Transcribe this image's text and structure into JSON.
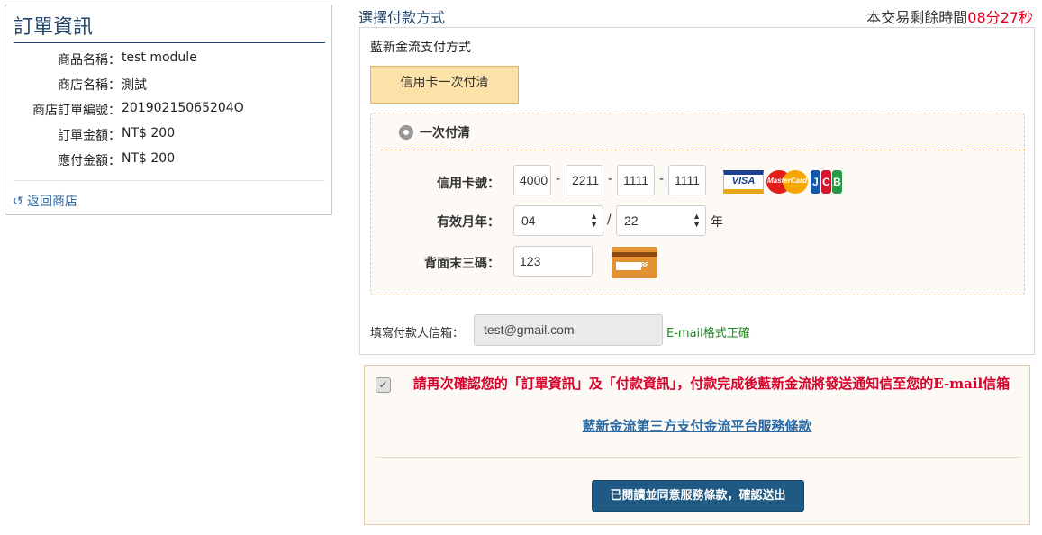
{
  "order": {
    "title": "訂單資訊",
    "rows": [
      {
        "key": "商品名稱：",
        "value": "test module"
      },
      {
        "key": "商店名稱：",
        "value": "測試"
      },
      {
        "key": "商店訂單編號：",
        "value": "20190215065204O"
      },
      {
        "key": "訂單金額：",
        "value": "NT$ 200"
      },
      {
        "key": "應付金額：",
        "value": "NT$ 200"
      }
    ],
    "back_link": "返回商店",
    "back_icon": "undo-icon"
  },
  "payment": {
    "heading": "選擇付款方式",
    "timer_label": "本交易剩餘時間",
    "timer_value": "08分27秒",
    "method_title": "藍新金流支付方式",
    "method_button": "信用卡一次付清",
    "option_label": "一次付清",
    "card_number_label": "信用卡號：",
    "card_number": [
      "4000",
      "2211",
      "1111",
      "1111"
    ],
    "separator": "-",
    "expiry_label": "有效月年：",
    "expiry_month": "04",
    "expiry_slash": "/",
    "expiry_year": "22",
    "expiry_suffix": "年",
    "cvv_label": "背面末三碼：",
    "cvv": "123",
    "cvv_icon_text": "888",
    "card_brands": [
      "VISA",
      "MasterCard",
      "JCB"
    ],
    "email_label": "填寫付款人信箱：",
    "email": "test@gmail.com",
    "email_status": "E-mail格式正確"
  },
  "confirm": {
    "notice": "請再次確認您的「訂單資訊」及「付款資訊」，付款完成後藍新金流將發送通知信至您的E-mail信箱",
    "terms_link": "藍新金流第三方支付金流平台服務條款",
    "submit": "已閱讀並同意服務條款，確認送出",
    "checked": true
  },
  "colors": {
    "title_blue": "#22456b",
    "timer_red": "#e0001b",
    "notice_red": "#d6002a",
    "link_blue": "#2a6aa5",
    "button_blue": "#1f5a84",
    "method_yellow": "#fbe2a8",
    "ok_green": "#1c8a1c"
  }
}
